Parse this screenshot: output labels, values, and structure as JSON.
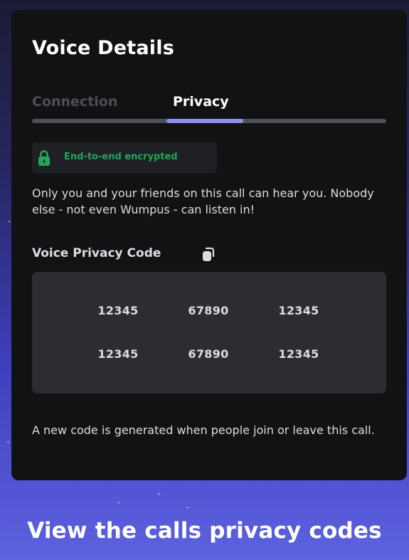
{
  "modal": {
    "title": "Voice Details",
    "tabs": [
      {
        "label": "Connection",
        "active": false
      },
      {
        "label": "Privacy",
        "active": true
      }
    ],
    "encryption_badge": {
      "icon": "lock-icon",
      "text": "End-to-end encrypted",
      "color": "#23a55a"
    },
    "description": "Only you and your friends on this call can hear you. Nobody else - not even Wumpus - can listen in!",
    "privacy_code": {
      "heading": "Voice Privacy Code",
      "copy_icon": "copy-icon",
      "rows": [
        [
          "12345",
          "67890",
          "12345"
        ],
        [
          "12345",
          "67890",
          "12345"
        ]
      ]
    },
    "footer_note": "A new code is generated when people join or leave this call."
  },
  "caption": "View the calls privacy codes",
  "colors": {
    "modal_bg": "#111214",
    "accent": "#8c8fec",
    "inactive_tab": "#4e5058",
    "code_box_bg": "#2b2d31"
  }
}
